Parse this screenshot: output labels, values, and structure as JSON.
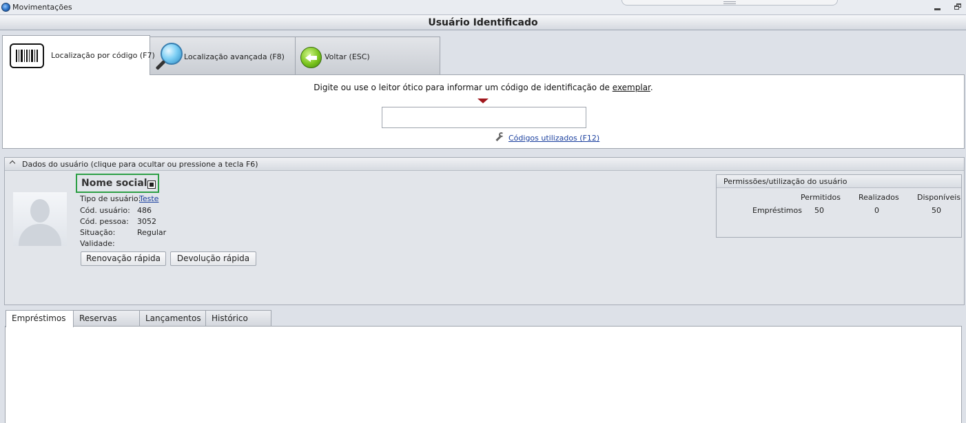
{
  "window": {
    "title": "Movimentações"
  },
  "header": {
    "title": "Usuário Identificado"
  },
  "top_tabs": [
    {
      "label": "Localização por código (F7)",
      "icon": "barcode-icon",
      "active": true
    },
    {
      "label": "Localização avançada (F8)",
      "icon": "magnifier-icon",
      "active": false
    },
    {
      "label": "Voltar (ESC)",
      "icon": "back-arrow-icon",
      "active": false
    }
  ],
  "search": {
    "instruction": "Digite ou use o leitor ótico para informar um código de identificação de ",
    "instruction_link": "exemplar",
    "instruction_end": ".",
    "input_value": "",
    "codes_link": "Códigos utilizados (F12)"
  },
  "user_panel": {
    "title": "Dados do usuário (clique para ocultar ou pressione a tecla F6)",
    "social_name": "Nome social",
    "fields": [
      {
        "label": "Tipo de usuário:",
        "value": "Teste",
        "link": true
      },
      {
        "label": "Cód. usuário:",
        "value": "486"
      },
      {
        "label": "Cód. pessoa:",
        "value": "3052"
      },
      {
        "label": "Situação:",
        "value": "Regular"
      },
      {
        "label": "Validade:",
        "value": ""
      }
    ],
    "buttons": {
      "quick_renewal": "Renovação rápida",
      "quick_return": "Devolução rápida"
    }
  },
  "permissions": {
    "title": "Permissões/utilização do usuário",
    "columns": [
      "Permitidos",
      "Realizados",
      "Disponíveis"
    ],
    "rows": [
      {
        "label": "Empréstimos",
        "values": [
          "50",
          "0",
          "50"
        ]
      }
    ]
  },
  "bottom_tabs": [
    {
      "label": "Empréstimos",
      "active": true
    },
    {
      "label": "Reservas",
      "active": false
    },
    {
      "label": "Lançamentos",
      "active": false
    },
    {
      "label": "Histórico",
      "active": false
    }
  ]
}
